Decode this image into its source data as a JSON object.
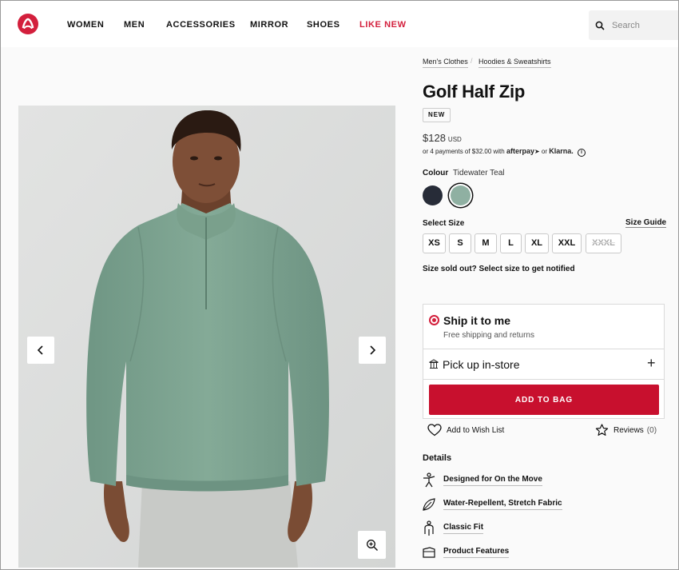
{
  "header": {
    "nav": [
      "WOMEN",
      "MEN",
      "ACCESSORIES",
      "MIRROR",
      "SHOES",
      "LIKE NEW"
    ],
    "search_placeholder": "Search"
  },
  "breadcrumb": [
    "Men's Clothes",
    "Hoodies & Sweatshirts"
  ],
  "product": {
    "title": "Golf Half Zip",
    "badge": "NEW",
    "price": "$128",
    "currency": "USD",
    "installments_text": "or 4 payments of $32.00 with",
    "afterpay": "afterpay",
    "or": "or",
    "klarna": "Klarna.",
    "colour_label": "Colour",
    "colour_name": "Tidewater Teal",
    "swatches": [
      "#272c38",
      "#8fb0a2"
    ],
    "size_label": "Select Size",
    "size_guide": "Size Guide",
    "sizes": [
      "XS",
      "S",
      "M",
      "L",
      "XL",
      "XXL",
      "XXXL"
    ],
    "sold_out_note": "Size sold out? Select size to get notified"
  },
  "delivery": {
    "ship_title": "Ship it to me",
    "ship_sub": "Free shipping and returns",
    "pickup_title": "Pick up in-store",
    "add_to_bag": "ADD TO BAG"
  },
  "actions": {
    "wishlist": "Add to Wish List",
    "reviews": "Reviews",
    "reviews_count": "(0)"
  },
  "details": {
    "heading": "Details",
    "items": [
      "Designed for On the Move",
      "Water-Repellent, Stretch Fabric",
      "Classic Fit",
      "Product Features"
    ]
  },
  "colors": {
    "brand": "#d31f3c",
    "button": "#c8102e",
    "garment": "#7fa592"
  }
}
